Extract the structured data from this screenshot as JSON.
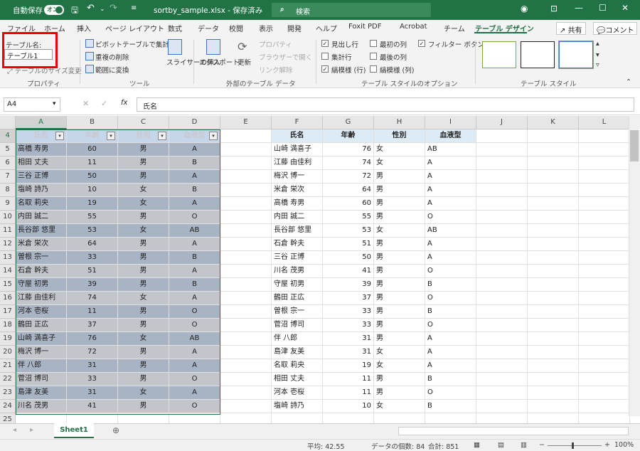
{
  "titlebar": {
    "autosave_label": "自動保存",
    "autosave_state": "オン",
    "filename": "sortby_sample.xlsx - 保存済み",
    "search_placeholder": "検索"
  },
  "tabs": [
    "ファイル",
    "ホーム",
    "挿入",
    "ページ レイアウト",
    "数式",
    "データ",
    "校閲",
    "表示",
    "開発",
    "ヘルプ",
    "Foxit PDF",
    "Acrobat",
    "チーム",
    "テーブル デザイン"
  ],
  "share_label": "共有",
  "comment_label": "コメント",
  "ribbon": {
    "table_name_label": "テーブル名:",
    "table_name_value": "テーブル1",
    "resize_label": "テーブルのサイズ変更",
    "properties_group": "プロパティ",
    "pivot_label": "ピボットテーブルで集計",
    "dedupe_label": "重複の削除",
    "convert_label": "範囲に変換",
    "slicer_label": "スライサーの挿入",
    "tools_group": "ツール",
    "export_label": "エクスポート",
    "refresh_label": "更新",
    "props_label": "プロパティ",
    "browser_label": "ブラウザーで開く",
    "unlink_label": "リンク解除",
    "external_group": "外部のテーブル データ",
    "options": [
      {
        "label": "見出し行",
        "checked": true
      },
      {
        "label": "集計行",
        "checked": false
      },
      {
        "label": "縞模様 (行)",
        "checked": true
      },
      {
        "label": "最初の列",
        "checked": false
      },
      {
        "label": "最後の列",
        "checked": false
      },
      {
        "label": "縞模様 (列)",
        "checked": false
      },
      {
        "label": "フィルター ボタン",
        "checked": true
      }
    ],
    "style_options_group": "テーブル スタイルのオプション",
    "styles_group": "テーブル スタイル"
  },
  "formula": {
    "cell_ref": "A4",
    "content": "氏名"
  },
  "columns": [
    "A",
    "B",
    "C",
    "D",
    "E",
    "F",
    "G",
    "H",
    "I",
    "J",
    "K",
    "L"
  ],
  "row_numbers": [
    "4",
    "5",
    "6",
    "7",
    "8",
    "9",
    "10",
    "11",
    "12",
    "13",
    "14",
    "15",
    "16",
    "17",
    "18",
    "19",
    "20",
    "21",
    "22",
    "23",
    "24",
    "25"
  ],
  "table_headers": [
    "氏名",
    "年齢",
    "性別",
    "血液型"
  ],
  "left_table": [
    [
      "高橋 寿男",
      "60",
      "男",
      "A"
    ],
    [
      "相田 丈夫",
      "11",
      "男",
      "B"
    ],
    [
      "三谷 正博",
      "50",
      "男",
      "A"
    ],
    [
      "塩崎 詩乃",
      "10",
      "女",
      "B"
    ],
    [
      "名取 莉央",
      "19",
      "女",
      "A"
    ],
    [
      "内田 誠二",
      "55",
      "男",
      "O"
    ],
    [
      "長谷部 悠里",
      "53",
      "女",
      "AB"
    ],
    [
      "米倉 栄次",
      "64",
      "男",
      "A"
    ],
    [
      "曽根 宗一",
      "33",
      "男",
      "B"
    ],
    [
      "石倉 幹夫",
      "51",
      "男",
      "A"
    ],
    [
      "守屋 初男",
      "39",
      "男",
      "B"
    ],
    [
      "江藤 由佳利",
      "74",
      "女",
      "A"
    ],
    [
      "河本 壱桜",
      "11",
      "男",
      "O"
    ],
    [
      "鶴田 正広",
      "37",
      "男",
      "O"
    ],
    [
      "山崎 満喜子",
      "76",
      "女",
      "AB"
    ],
    [
      "梅沢 博一",
      "72",
      "男",
      "A"
    ],
    [
      "伴 八郎",
      "31",
      "男",
      "A"
    ],
    [
      "菅沼 博司",
      "33",
      "男",
      "O"
    ],
    [
      "島津 友美",
      "31",
      "女",
      "A"
    ],
    [
      "川名 茂男",
      "41",
      "男",
      "O"
    ]
  ],
  "right_table": [
    [
      "山崎 満喜子",
      "76",
      "女",
      "AB"
    ],
    [
      "江藤 由佳利",
      "74",
      "女",
      "A"
    ],
    [
      "梅沢 博一",
      "72",
      "男",
      "A"
    ],
    [
      "米倉 栄次",
      "64",
      "男",
      "A"
    ],
    [
      "高橋 寿男",
      "60",
      "男",
      "A"
    ],
    [
      "内田 誠二",
      "55",
      "男",
      "O"
    ],
    [
      "長谷部 悠里",
      "53",
      "女",
      "AB"
    ],
    [
      "石倉 幹夫",
      "51",
      "男",
      "A"
    ],
    [
      "三谷 正博",
      "50",
      "男",
      "A"
    ],
    [
      "川名 茂男",
      "41",
      "男",
      "O"
    ],
    [
      "守屋 初男",
      "39",
      "男",
      "B"
    ],
    [
      "鶴田 正広",
      "37",
      "男",
      "O"
    ],
    [
      "曽根 宗一",
      "33",
      "男",
      "B"
    ],
    [
      "菅沼 博司",
      "33",
      "男",
      "O"
    ],
    [
      "伴 八郎",
      "31",
      "男",
      "A"
    ],
    [
      "島津 友美",
      "31",
      "女",
      "A"
    ],
    [
      "名取 莉央",
      "19",
      "女",
      "A"
    ],
    [
      "相田 丈夫",
      "11",
      "男",
      "B"
    ],
    [
      "河本 壱桜",
      "11",
      "男",
      "O"
    ],
    [
      "塩崎 詩乃",
      "10",
      "女",
      "B"
    ]
  ],
  "sheet_tab": "Sheet1",
  "status": {
    "average": "平均: 42.55",
    "count": "データの個数: 84",
    "sum": "合計: 851",
    "zoom": "100%"
  }
}
